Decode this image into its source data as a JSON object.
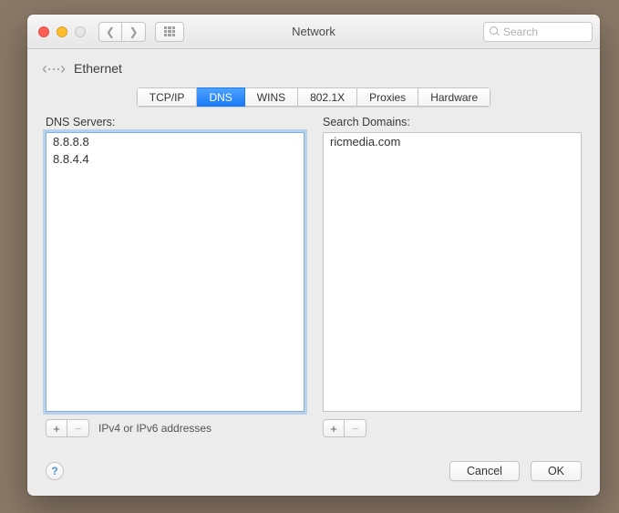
{
  "window": {
    "title": "Network",
    "search_placeholder": "Search"
  },
  "header": {
    "interface_name": "Ethernet"
  },
  "tabs": [
    {
      "label": "TCP/IP",
      "active": false
    },
    {
      "label": "DNS",
      "active": true
    },
    {
      "label": "WINS",
      "active": false
    },
    {
      "label": "802.1X",
      "active": false
    },
    {
      "label": "Proxies",
      "active": false
    },
    {
      "label": "Hardware",
      "active": false
    }
  ],
  "dns": {
    "label": "DNS Servers:",
    "servers": [
      "8.8.8.8",
      "8.8.4.4"
    ],
    "hint": "IPv4 or IPv6 addresses",
    "add_label": "+",
    "remove_label": "−"
  },
  "domains": {
    "label": "Search Domains:",
    "items": [
      "ricmedia.com"
    ],
    "add_label": "+",
    "remove_label": "−"
  },
  "footer": {
    "help_label": "?",
    "cancel_label": "Cancel",
    "ok_label": "OK"
  }
}
